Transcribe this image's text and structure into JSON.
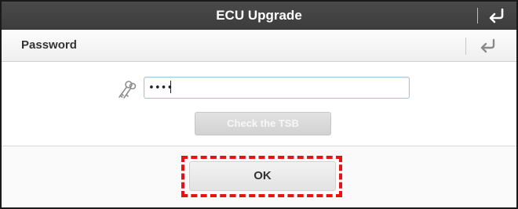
{
  "window": {
    "title": "ECU Upgrade"
  },
  "dialog": {
    "title": "Password",
    "password_value": "••••"
  },
  "buttons": {
    "check_tsb_label": "Check the TSB",
    "ok_label": "OK"
  },
  "icons": {
    "top_back": "return-arrow-icon",
    "dialog_back": "return-arrow-icon",
    "password": "key-icon"
  },
  "colors": {
    "titlebar": "#424242",
    "input_border": "#9cc6dc",
    "disabled_button": "#d8d8d8",
    "highlight_dash": "#e41414"
  }
}
